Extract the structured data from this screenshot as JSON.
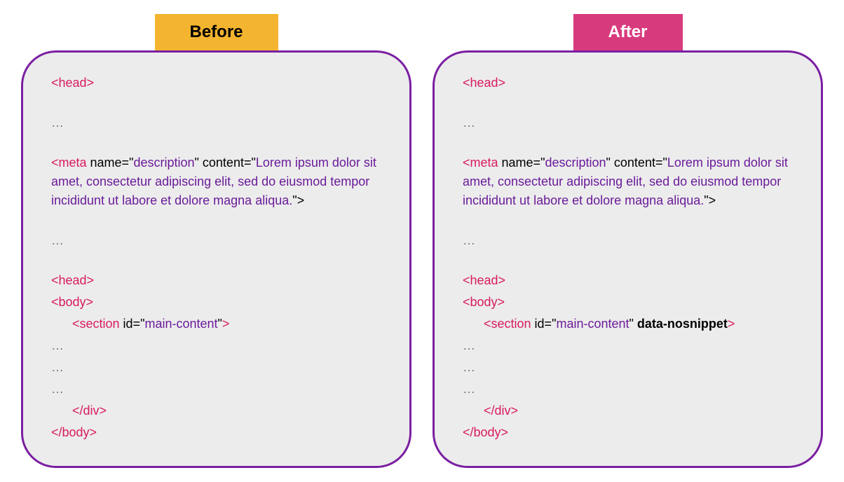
{
  "labels": {
    "before": "Before",
    "after": "After"
  },
  "code": {
    "headOpen": "<head>",
    "ellipsis": "…",
    "metaOpen": "<meta",
    "nameAttr": " name=",
    "quoteOpen": "\"",
    "nameValue": "description",
    "contentAttr": " content=",
    "metaContent": "Lorem ipsum dolor sit amet, consectetur adipiscing elit, sed do eiusmod tempor incididunt ut labore et dolore magna aliqua.",
    "quoteCloseTag": "\">",
    "headClose": "<head>",
    "bodyOpen": "<body>",
    "sectionOpen": "<section",
    "idAttr": " id=",
    "idValue": "main-content",
    "sectionBeforeEnd": ">",
    "dataNosnippet": " data-nosnippet",
    "sectionAfterEnd": ">",
    "divClose": "</div>",
    "bodyClose": "</body>"
  }
}
